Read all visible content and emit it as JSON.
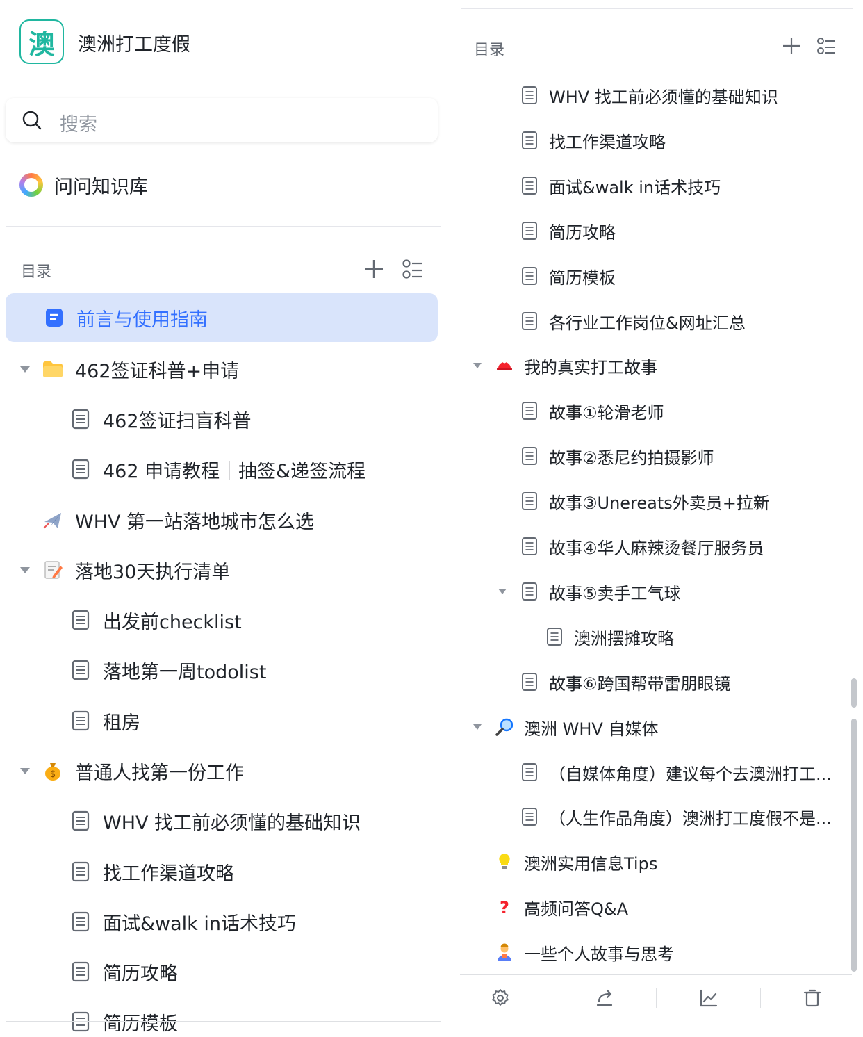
{
  "app": {
    "logo_char": "澳",
    "title": "澳洲打工度假"
  },
  "search": {
    "placeholder": "搜索"
  },
  "ask": {
    "label": "问问知识库"
  },
  "left_toc": {
    "header": "目录",
    "items": [
      {
        "label": "前言与使用指南",
        "icon": "doc-filled-icon",
        "active": true
      },
      {
        "label": "462签证科普+申请",
        "icon": "folder-icon",
        "expanded": true
      },
      {
        "label": "462签证扫盲科普",
        "icon": "doc-icon"
      },
      {
        "label": "462 申请教程｜抽签&递签流程",
        "icon": "doc-icon"
      },
      {
        "label": "WHV 第一站落地城市怎么选",
        "icon": "airplane-icon"
      },
      {
        "label": "落地30天执行清单",
        "icon": "memo-icon",
        "expanded": true
      },
      {
        "label": "出发前checklist",
        "icon": "doc-icon"
      },
      {
        "label": "落地第一周todolist",
        "icon": "doc-icon"
      },
      {
        "label": "租房",
        "icon": "doc-icon"
      },
      {
        "label": "普通人找第一份工作",
        "icon": "money-bag-icon",
        "expanded": true
      },
      {
        "label": "WHV 找工前必须懂的基础知识",
        "icon": "doc-icon"
      },
      {
        "label": "找工作渠道攻略",
        "icon": "doc-icon"
      },
      {
        "label": "面试&walk in话术技巧",
        "icon": "doc-icon"
      },
      {
        "label": "简历攻略",
        "icon": "doc-icon"
      },
      {
        "label": "简历模板",
        "icon": "doc-icon"
      }
    ]
  },
  "right_toc": {
    "header": "目录",
    "items": [
      {
        "label": "WHV 找工前必须懂的基础知识",
        "icon": "doc-icon"
      },
      {
        "label": "找工作渠道攻略",
        "icon": "doc-icon"
      },
      {
        "label": "面试&walk in话术技巧",
        "icon": "doc-icon"
      },
      {
        "label": "简历攻略",
        "icon": "doc-icon"
      },
      {
        "label": "简历模板",
        "icon": "doc-icon"
      },
      {
        "label": "各行业工作岗位&网址汇总",
        "icon": "doc-icon"
      },
      {
        "label": "我的真实打工故事",
        "icon": "hat-icon",
        "expanded": true
      },
      {
        "label": "故事①轮滑老师",
        "icon": "doc-icon"
      },
      {
        "label": "故事②悉尼约拍摄影师",
        "icon": "doc-icon"
      },
      {
        "label": "故事③Unereats外卖员+拉新",
        "icon": "doc-icon"
      },
      {
        "label": "故事④华人麻辣烫餐厅服务员",
        "icon": "doc-icon"
      },
      {
        "label": "故事⑤卖手工气球",
        "icon": "doc-icon",
        "expanded": true
      },
      {
        "label": "澳洲摆摊攻略",
        "icon": "doc-icon"
      },
      {
        "label": "故事⑥跨国帮带雷朋眼镜",
        "icon": "doc-icon"
      },
      {
        "label": "澳洲 WHV 自媒体",
        "icon": "magnifier-icon",
        "expanded": true
      },
      {
        "label": "（自媒体角度）建议每个去澳洲打工...",
        "icon": "doc-icon"
      },
      {
        "label": "（人生作品角度）澳洲打工度假不是...",
        "icon": "doc-icon"
      },
      {
        "label": "澳洲实用信息Tips",
        "icon": "bulb-icon"
      },
      {
        "label": "高频问答Q&A",
        "icon": "question-icon"
      },
      {
        "label": "一些个人故事与思考",
        "icon": "person-icon"
      }
    ]
  },
  "footer": {
    "buttons": [
      "settings-icon",
      "share-icon",
      "chart-icon",
      "trash-icon"
    ]
  },
  "colors": {
    "accent": "#3370ff",
    "active_bg": "#d9e4fb",
    "logo": "#20b7a0"
  }
}
